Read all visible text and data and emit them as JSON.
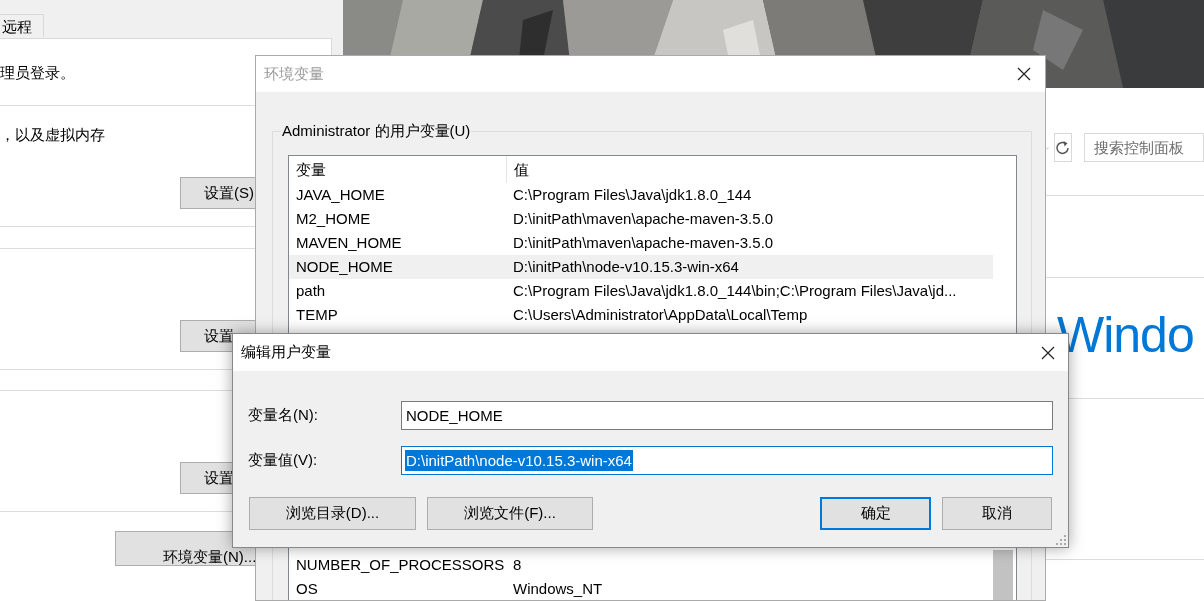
{
  "system_properties": {
    "tabs": [
      {
        "label": "远程",
        "selected": false
      }
    ],
    "texts": [
      "理员登录。",
      "，以及虚拟内存"
    ],
    "buttons": [
      "设置(S)",
      "设置",
      "设置",
      "环境变量(N)..."
    ]
  },
  "control_panel": {
    "search": {
      "placeholder": "搜索控制面板"
    },
    "heading": "Windo"
  },
  "env_window": {
    "title": "环境变量",
    "user_group": "Administrator 的用户变量(U)",
    "columns": [
      "变量",
      "值"
    ],
    "user_rows": [
      {
        "name": "JAVA_HOME",
        "value": "C:\\Program Files\\Java\\jdk1.8.0_144",
        "selected": false
      },
      {
        "name": "M2_HOME",
        "value": "D:\\initPath\\maven\\apache-maven-3.5.0",
        "selected": false
      },
      {
        "name": "MAVEN_HOME",
        "value": "D:\\initPath\\maven\\apache-maven-3.5.0",
        "selected": false
      },
      {
        "name": "NODE_HOME",
        "value": "D:\\initPath\\node-v10.15.3-win-x64",
        "selected": true
      },
      {
        "name": "path",
        "value": "C:\\Program Files\\Java\\jdk1.8.0_144\\bin;C:\\Program Files\\Java\\jd...",
        "selected": false
      },
      {
        "name": "TEMP",
        "value": "C:\\Users\\Administrator\\AppData\\Local\\Temp",
        "selected": false
      }
    ],
    "system_rows": [
      {
        "name": "NUMBER_OF_PROCESSORS",
        "value": "8",
        "selected": false
      },
      {
        "name": "OS",
        "value": "Windows_NT",
        "selected": false
      }
    ]
  },
  "edit_dialog": {
    "title": "编辑用户变量",
    "fields": [
      {
        "label": "变量名(N):",
        "value": "NODE_HOME",
        "focused": false
      },
      {
        "label": "变量值(V):",
        "value": "D:\\initPath\\node-v10.15.3-win-x64",
        "focused": true
      }
    ],
    "buttons": [
      {
        "label": "浏览目录(D)...",
        "default": false
      },
      {
        "label": "浏览文件(F)...",
        "default": false
      },
      {
        "label": "确定",
        "default": true
      },
      {
        "label": "取消",
        "default": false
      }
    ]
  }
}
